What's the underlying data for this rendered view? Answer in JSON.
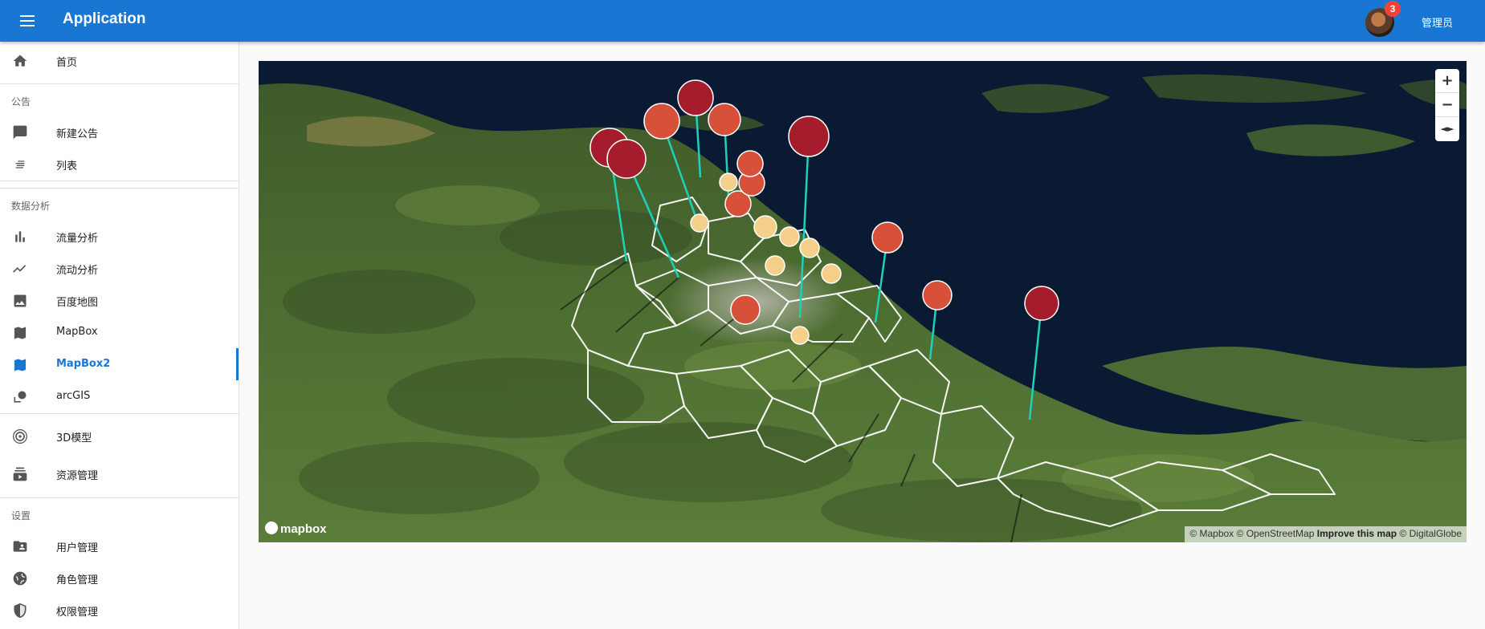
{
  "app": {
    "title": "Application",
    "user_name": "管理员",
    "notification_count": "3"
  },
  "sidebar": {
    "home": "首页",
    "section_notice": "公告",
    "new_notice": "新建公告",
    "list": "列表",
    "section_analysis": "数据分析",
    "traffic_analysis": "流量分析",
    "flow_analysis": "流动分析",
    "baidu_map": "百度地图",
    "mapbox": "MapBox",
    "mapbox2": "MapBox2",
    "arcgis": "arcGIS",
    "model_3d": "3D模型",
    "resource_mgmt": "资源管理",
    "section_settings": "设置",
    "user_mgmt": "用户管理",
    "role_mgmt": "角色管理",
    "permission_mgmt": "权限管理"
  },
  "map": {
    "zoom_in": "+",
    "zoom_out": "−",
    "compass": "◄►",
    "logo": "mapbox",
    "attribution_1": "© Mapbox © OpenStreetMap",
    "attribution_2": "Improve this map",
    "attribution_3": "© DigitalGlobe",
    "colors": {
      "high": "#a51c2c",
      "mid": "#d6503a",
      "low": "#f4d08a",
      "stem": "#1fd1b8"
    }
  }
}
